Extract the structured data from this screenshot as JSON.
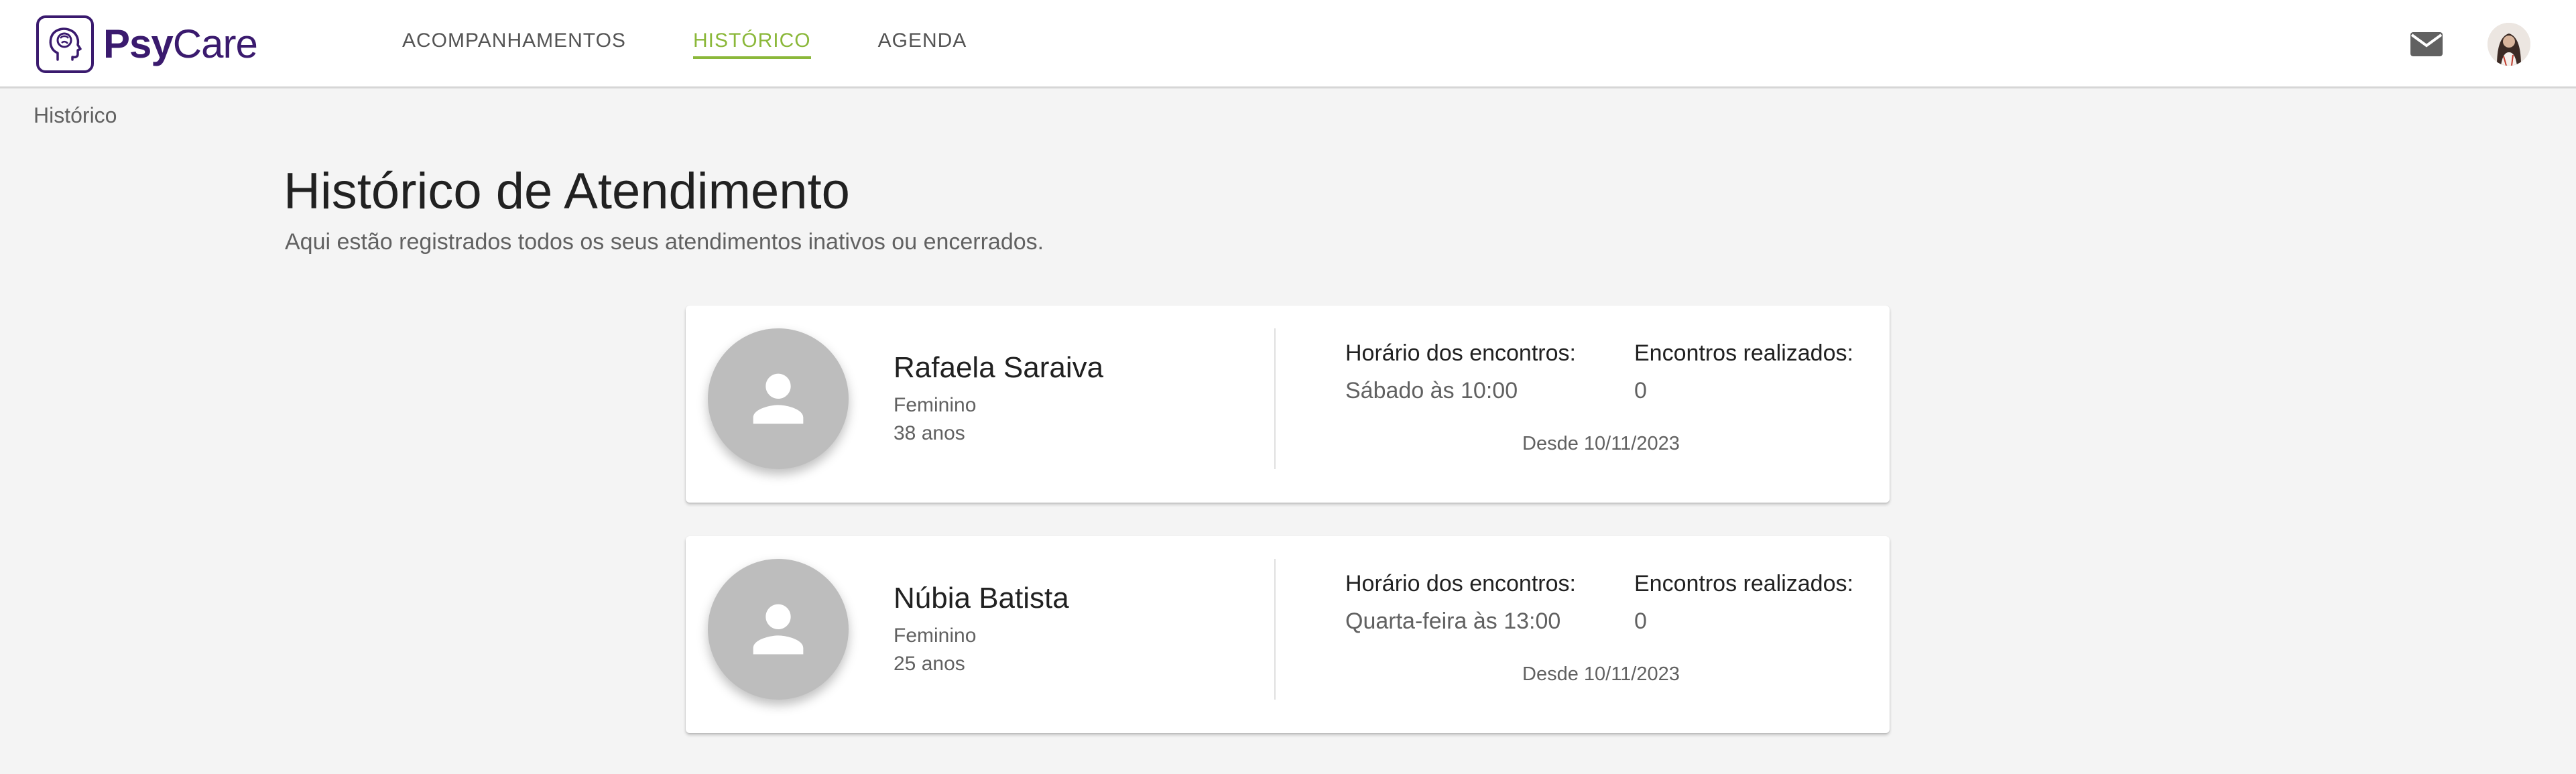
{
  "header": {
    "logo": {
      "part1": "Psy",
      "part2": "Care",
      "icon": "brain-head-icon"
    },
    "nav": [
      {
        "label": "ACOMPANHAMENTOS",
        "active": false
      },
      {
        "label": "HISTÓRICO",
        "active": true
      },
      {
        "label": "AGENDA",
        "active": false
      }
    ],
    "mail_icon": "mail-icon",
    "accent_color": "#8bb83a",
    "brand_color": "#3a1a6e"
  },
  "breadcrumb": "Histórico",
  "page": {
    "title": "Histórico de Atendimento",
    "subtitle": "Aqui estão registrados todos os seus atendimentos inativos ou encerrados."
  },
  "patients": [
    {
      "name": "Rafaela Saraiva",
      "gender": "Feminino",
      "age": "38 anos",
      "schedule_label": "Horário dos encontros:",
      "schedule_value": "Sábado às 10:00",
      "count_label": "Encontros realizados:",
      "count_value": "0",
      "since": "Desde 10/11/2023"
    },
    {
      "name": "Núbia Batista",
      "gender": "Feminino",
      "age": "25 anos",
      "schedule_label": "Horário dos encontros:",
      "schedule_value": "Quarta-feira às 13:00",
      "count_label": "Encontros realizados:",
      "count_value": "0",
      "since": "Desde 10/11/2023"
    }
  ]
}
